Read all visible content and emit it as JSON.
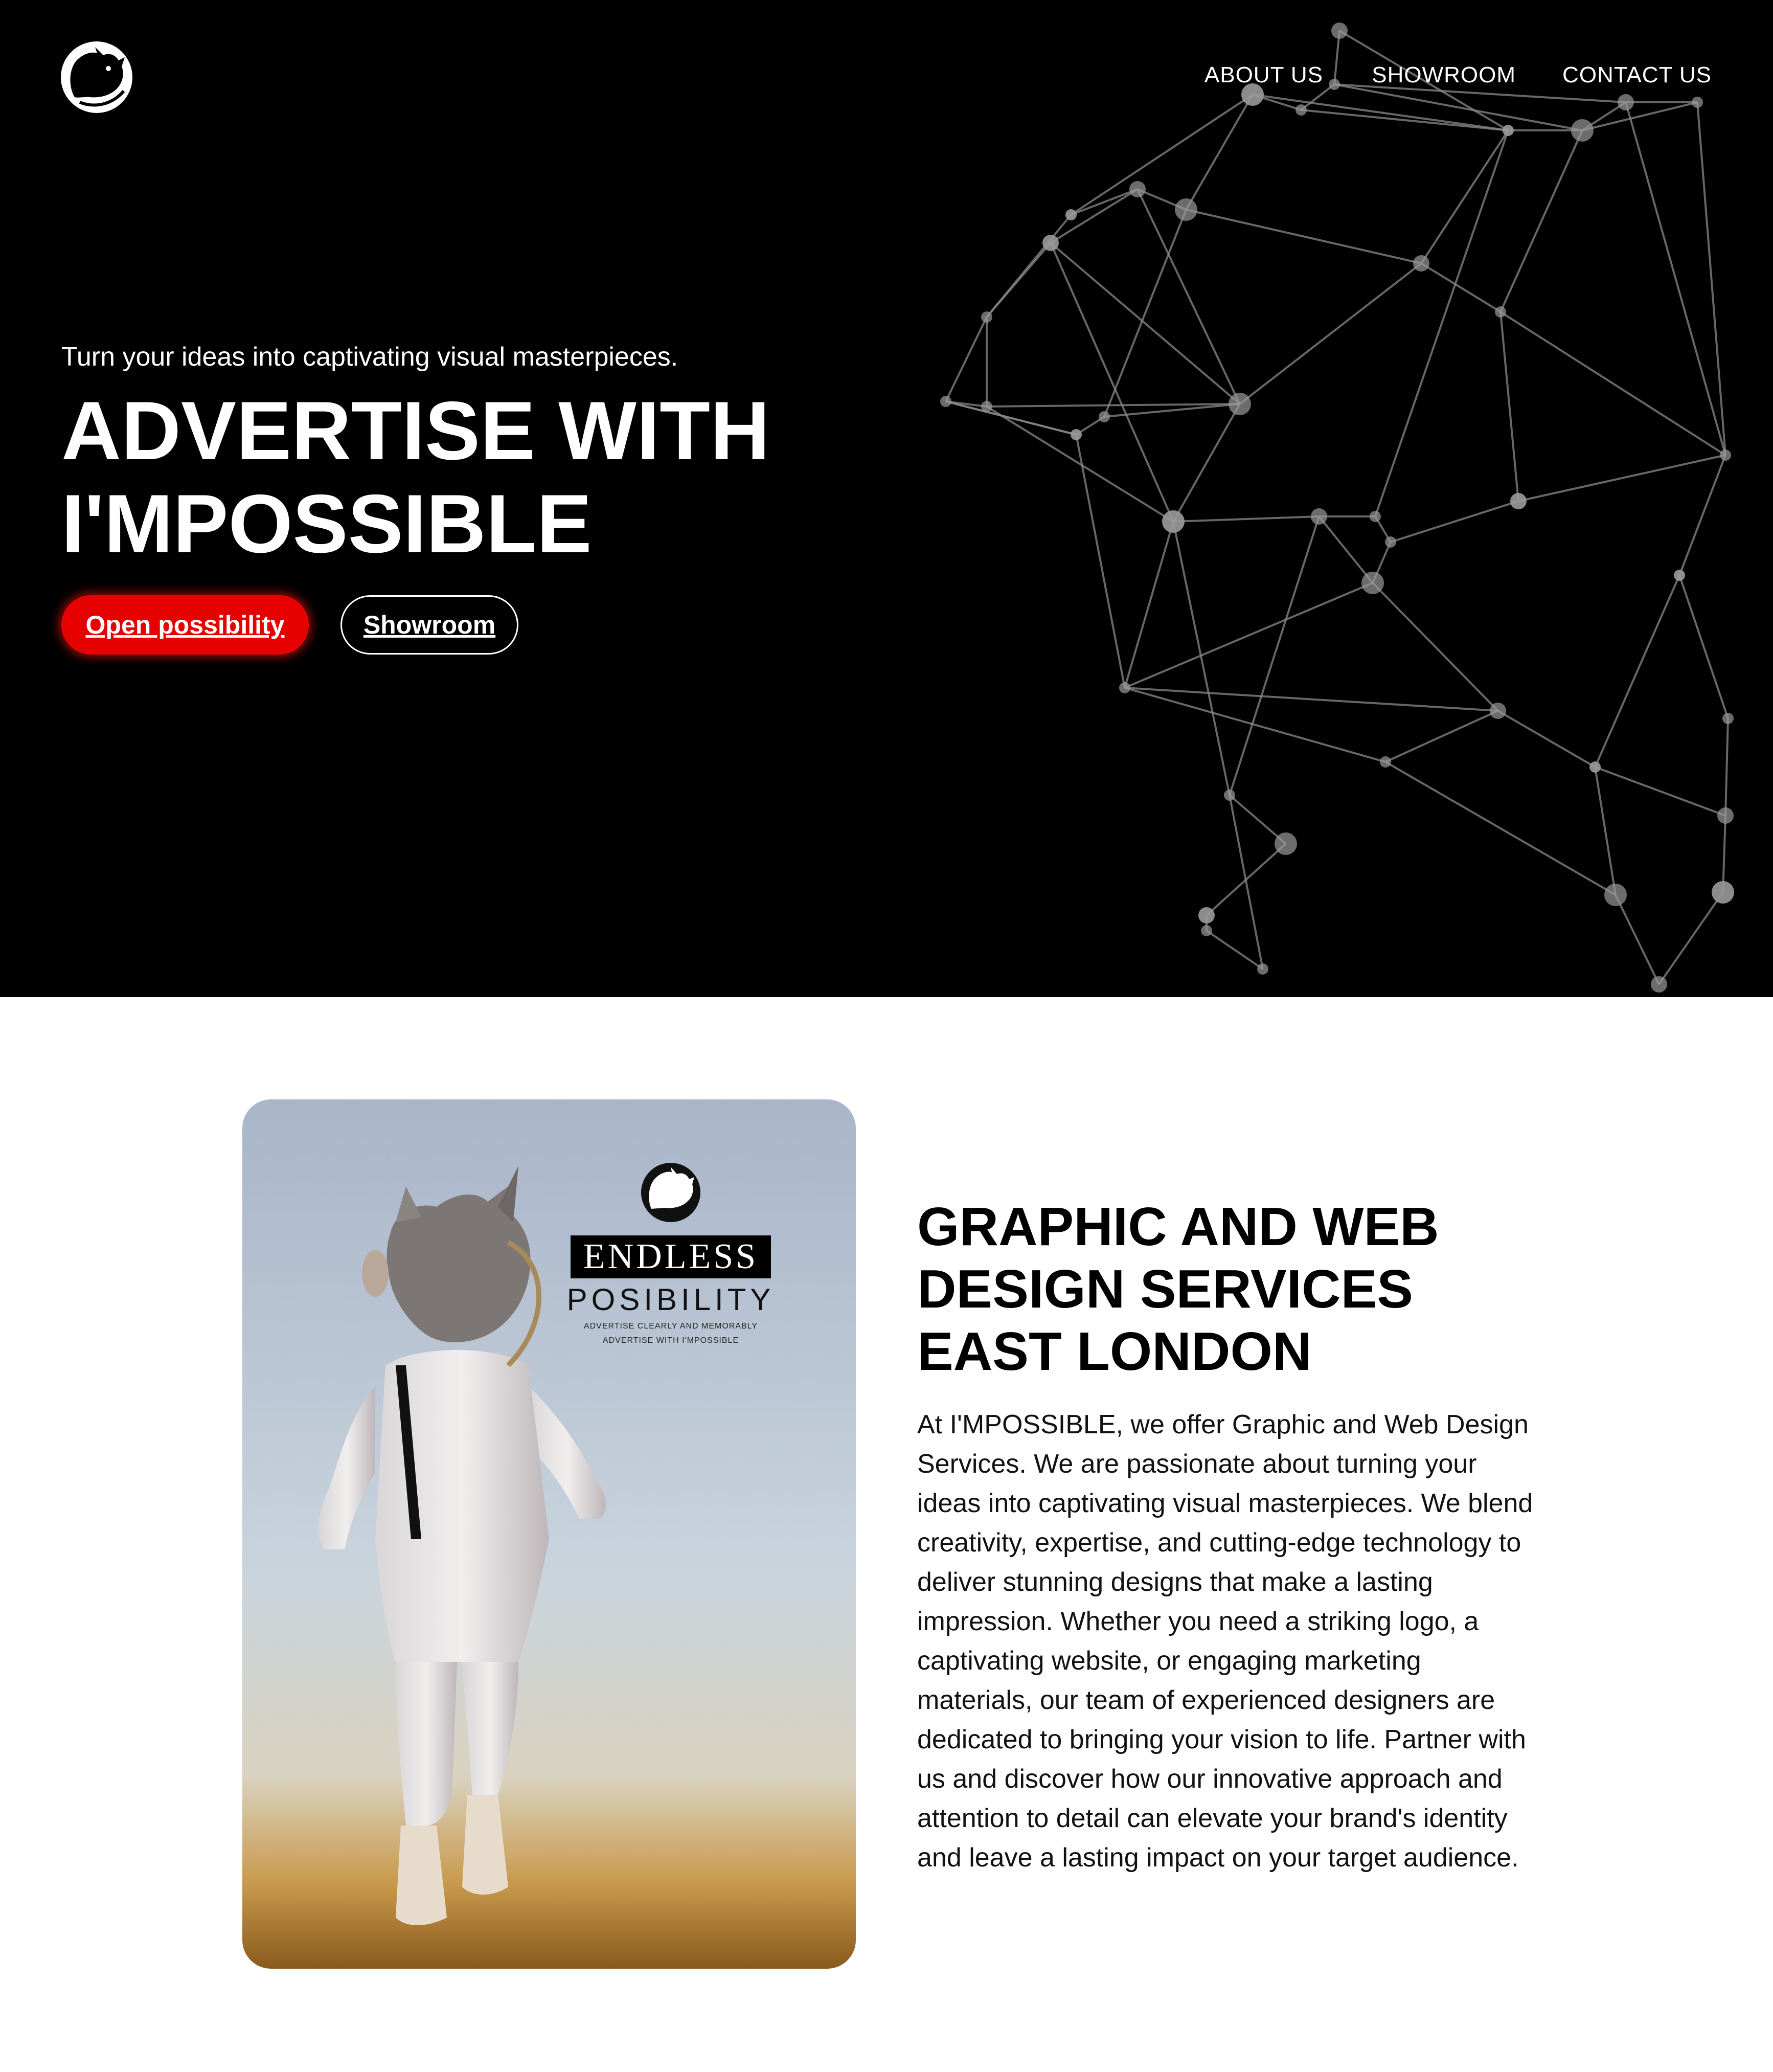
{
  "brand": {
    "logo_icon": "rhino-head-logo-icon"
  },
  "nav": {
    "items": [
      {
        "label": "ABOUT US"
      },
      {
        "label": "SHOWROOM"
      },
      {
        "label": "CONTACT US"
      }
    ]
  },
  "hero": {
    "tagline": "Turn your ideas into captivating visual masterpieces.",
    "headline_line1": "ADVERTISE WITH",
    "headline_line2": "I'MPOSSIBLE",
    "primary_button": "Open possibility",
    "secondary_button": "Showroom",
    "background_color": "#000000",
    "accent_color": "#e60000",
    "background_graphic": "network-mesh-rhino-head"
  },
  "poster": {
    "title": "ENDLESS",
    "subtitle": "POSIBILITY",
    "line1": "ADVERTISE CLEARLY AND MEMORABLY",
    "line2": "ADVERTISE WITH I'MPOSSIBLE",
    "image_subject": "rhino-headed astronaut floating above desert"
  },
  "services": {
    "title_line1": "GRAPHIC AND WEB",
    "title_line2": "DESIGN SERVICES",
    "title_line3": "EAST LONDON",
    "body": "At I'MPOSSIBLE, we offer Graphic and Web Design Services. We are passionate about turning your ideas into captivating visual masterpieces. We blend creativity, expertise, and cutting-edge technology to deliver stunning designs that make a lasting impression. Whether you need a striking logo, a captivating website, or engaging marketing materials, our team of experienced designers are dedicated to bringing your vision to life. Partner with us and discover how our innovative approach and attention to detail can elevate your brand's identity and leave a lasting impact on your target audience."
  }
}
